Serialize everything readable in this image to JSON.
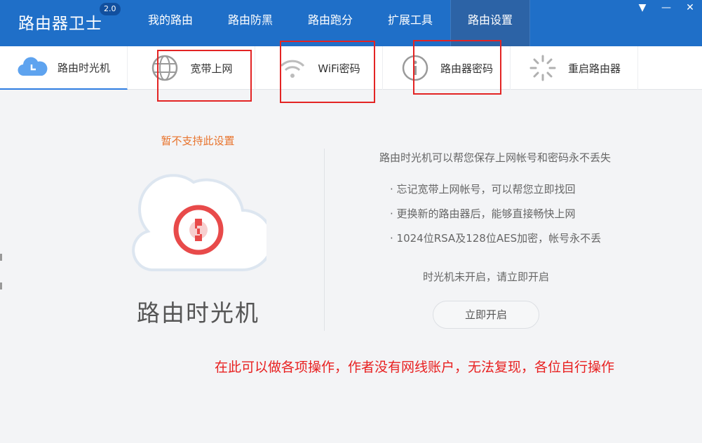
{
  "app": {
    "title": "路由器卫士",
    "version": "2.0"
  },
  "nav": {
    "items": [
      "我的路由",
      "路由防黑",
      "路由跑分",
      "扩展工具",
      "路由设置"
    ],
    "active_index": 4
  },
  "window": {
    "menu_icon": "▼",
    "minimize_icon": "—",
    "close_icon": "✕"
  },
  "subtabs": {
    "items": [
      {
        "label": "路由时光机",
        "icon": "cloud-clock-icon"
      },
      {
        "label": "宽带上网",
        "icon": "globe-icon"
      },
      {
        "label": "WiFi密码",
        "icon": "wifi-icon"
      },
      {
        "label": "路由器密码",
        "icon": "info-lock-icon"
      },
      {
        "label": "重启路由器",
        "icon": "loading-spinner-icon"
      }
    ],
    "active_index": 0
  },
  "content": {
    "warning": "暂不支持此设置",
    "feature_name": "路由时光机",
    "description_title": "路由时光机可以帮您保存上网帐号和密码永不丢失",
    "bullets": [
      "· 忘记宽带上网帐号，可以帮您立即找回",
      "· 更换新的路由器后，能够直接畅快上网",
      "· 1024位RSA及128位AES加密，帐号永不丢"
    ],
    "status": "时光机未开启，请立即开启",
    "open_button": "立即开启"
  },
  "annotation": {
    "note": "在此可以做各项操作，作者没有网线账户，无法复现，各位自行操作"
  },
  "colors": {
    "topbar": "#1f6fc8",
    "active_nav": "#2c63a6",
    "warning": "#e8732c",
    "annotation": "#e32424",
    "cloud_ring": "#e84a4a"
  }
}
